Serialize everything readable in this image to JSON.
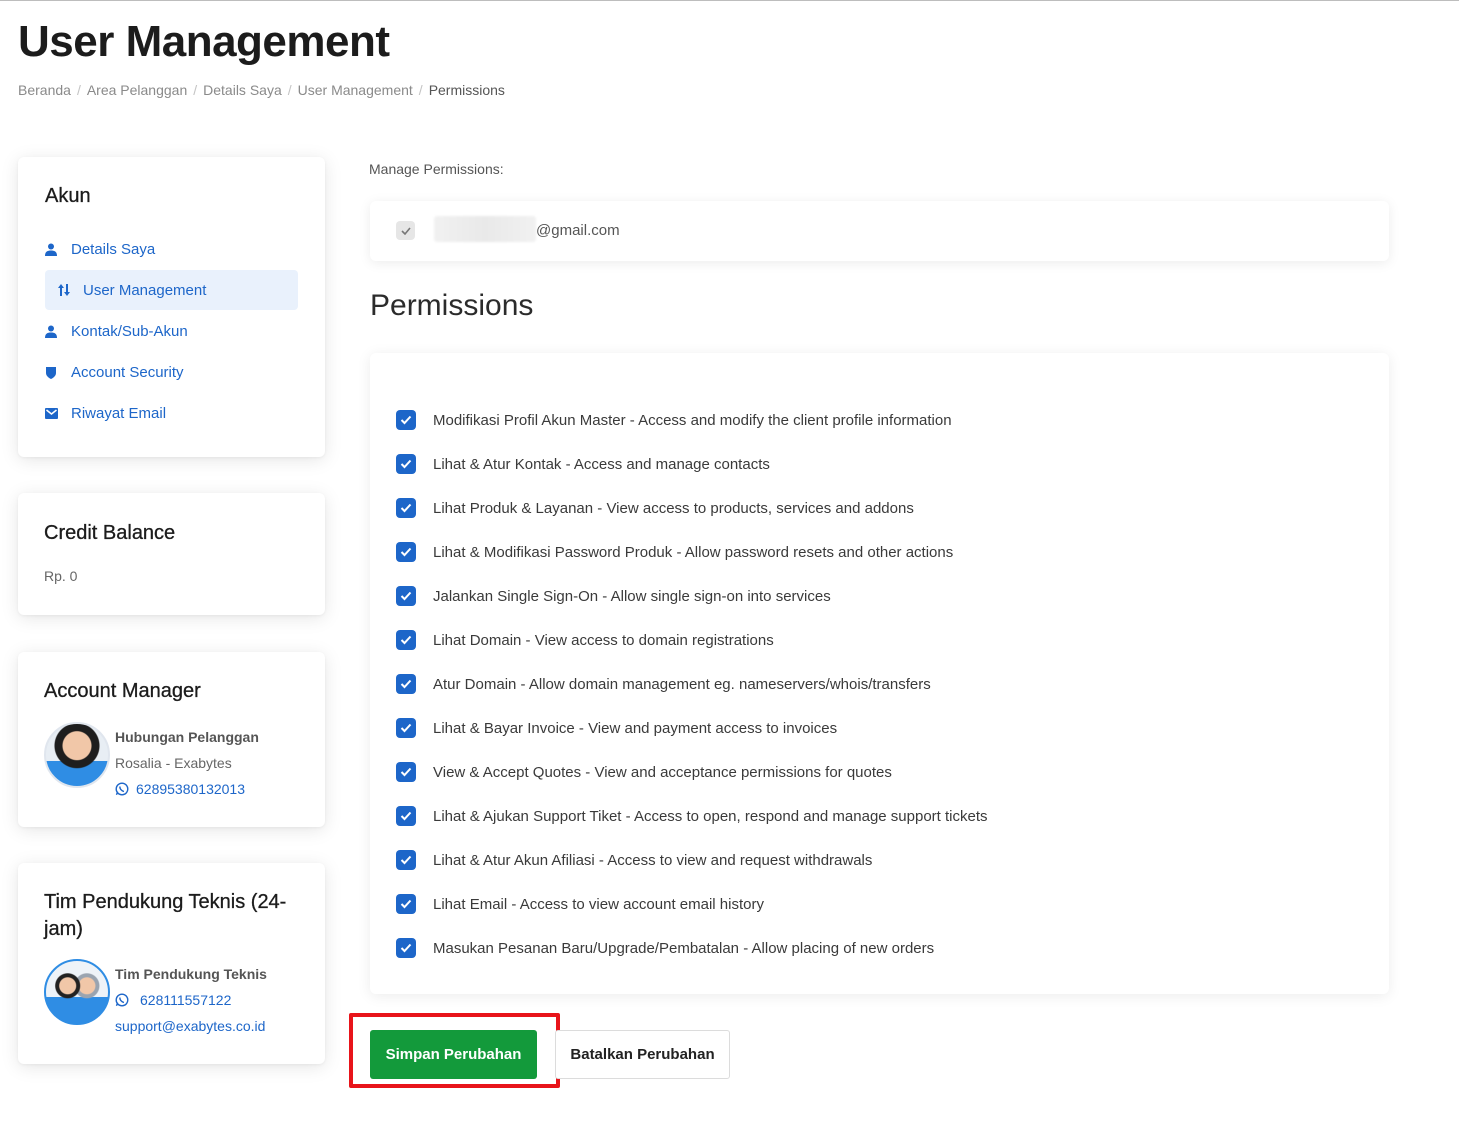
{
  "page": {
    "title": "User Management",
    "breadcrumb": [
      "Beranda",
      "Area Pelanggan",
      "Details Saya",
      "User Management",
      "Permissions"
    ]
  },
  "sidebar": {
    "akun": {
      "title": "Akun",
      "items": [
        {
          "label": "Details Saya",
          "icon": "user-icon",
          "active": false
        },
        {
          "label": "User Management",
          "icon": "sort-arrows-icon",
          "active": true
        },
        {
          "label": "Kontak/Sub-Akun",
          "icon": "user-icon",
          "active": false
        },
        {
          "label": "Account Security",
          "icon": "shield-icon",
          "active": false
        },
        {
          "label": "Riwayat Email",
          "icon": "envelope-icon",
          "active": false
        }
      ]
    },
    "credit": {
      "title": "Credit Balance",
      "value": "Rp. 0"
    },
    "manager": {
      "title": "Account Manager",
      "name": "Hubungan Pelanggan",
      "sub": "Rosalia - Exabytes",
      "phone": "62895380132013"
    },
    "support": {
      "title": "Tim Pendukung Teknis (24-jam)",
      "name": "Tim Pendukung Teknis",
      "phone": "628111557122",
      "email": "support@exabytes.co.id"
    }
  },
  "main": {
    "manage_label": "Manage Permissions:",
    "user_email": "@gmail.com",
    "permissions_heading": "Permissions",
    "permissions": [
      "Modifikasi Profil Akun Master - Access and modify the client profile information",
      "Lihat & Atur Kontak - Access and manage contacts",
      "Lihat Produk & Layanan - View access to products, services and addons",
      "Lihat & Modifikasi Password Produk - Allow password resets and other actions",
      "Jalankan Single Sign-On - Allow single sign-on into services",
      "Lihat Domain - View access to domain registrations",
      "Atur Domain - Allow domain management eg. nameservers/whois/transfers",
      "Lihat & Bayar Invoice - View and payment access to invoices",
      "View & Accept Quotes - View and acceptance permissions for quotes",
      "Lihat & Ajukan Support Tiket - Access to open, respond and manage support tickets",
      "Lihat & Atur Akun Afiliasi - Access to view and request withdrawals",
      "Lihat Email - Access to view account email history",
      "Masukan Pesanan Baru/Upgrade/Pembatalan - Allow placing of new orders"
    ],
    "save_label": "Simpan Perubahan",
    "cancel_label": "Batalkan Perubahan"
  },
  "colors": {
    "link": "#1d66c9",
    "save_button": "#139a3b",
    "highlight": "#e8141a",
    "checkbox": "#1d66c9"
  }
}
